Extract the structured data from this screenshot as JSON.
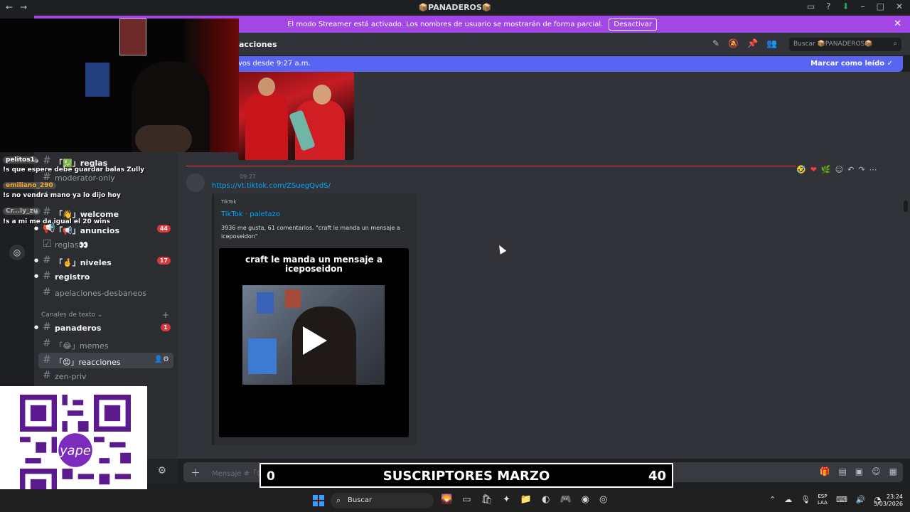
{
  "window": {
    "nav_back": "←",
    "nav_forward": "→",
    "title": "📦PANADEROS📦",
    "title_icon": "discord-icon"
  },
  "streamer_banner": {
    "text": "El modo Streamer está activado. Los nombres de usuario se mostrarán de forma parcial.",
    "button": "Desactivar",
    "close": "✕",
    "color": "#a346e6"
  },
  "header": {
    "channel_name": "acciones",
    "search_placeholder": "Buscar 📦PANADEROS📦"
  },
  "new_messages": {
    "text": "vos desde 9:27 a.m.",
    "mark_read": "Marcar como leído"
  },
  "sidebar": {
    "channels_top": [
      {
        "label": "「💹」reglas",
        "unread": true,
        "badge": ""
      },
      {
        "label": "moderator-only",
        "unread": false,
        "badge": ""
      },
      {
        "label": "「👋」welcome",
        "unread": true,
        "badge": ""
      },
      {
        "label": "「📢」anuncios",
        "unread": true,
        "badge": "44"
      },
      {
        "label": "reglas👀",
        "unread": false,
        "badge": ""
      },
      {
        "label": "「🤞」niveles",
        "unread": true,
        "badge": "17"
      },
      {
        "label": "registro",
        "unread": true,
        "badge": ""
      },
      {
        "label": "apelaciones-desbaneos",
        "unread": false,
        "badge": ""
      }
    ],
    "category": "Canales de texto",
    "channels_text": [
      {
        "label": "panaderos",
        "unread": true,
        "badge": "1"
      },
      {
        "label": "「😂」memes",
        "unread": false,
        "badge": ""
      },
      {
        "label": "「😡」reacciones",
        "unread": false,
        "badge": "",
        "active": true
      },
      {
        "label": "zen-priv",
        "unread": false,
        "badge": ""
      }
    ]
  },
  "message": {
    "time": "09:27",
    "link": "https://vt.tiktok.com/ZSuegQvdS/",
    "embed": {
      "provider": "TikTok",
      "author": "TikTok · paletazo",
      "description": "3936 me gusta, 61 comentarios. \"craft le manda un mensaje a iceposeidon\"",
      "video_title": "craft le manda un mensaje a iceposeidon"
    }
  },
  "composer": {
    "placeholder": "Mensaje #「😡」reacciones"
  },
  "stream_chat": [
    {
      "user": "pelitos1",
      "message": "!s que espere debe guardar balas Zully",
      "user_color": "#ffffff"
    },
    {
      "user": "emiliano_290",
      "message": "!s no vendrá mano ya lo dijo hoy",
      "user_color": "#f5a623"
    },
    {
      "user": "Cr...ly_zu",
      "message": "!s a mi me da igual el 20 wins",
      "user_color": "#b0b0b0"
    }
  ],
  "subs_overlay": {
    "current": "0",
    "title": "SUSCRIPTORES MARZO",
    "goal": "40"
  },
  "qr": {
    "brand": "yape"
  },
  "taskbar": {
    "search": "Buscar",
    "lang_1": "ESP",
    "lang_2": "LAA",
    "time": "23:24",
    "date": "5/03/2026"
  }
}
